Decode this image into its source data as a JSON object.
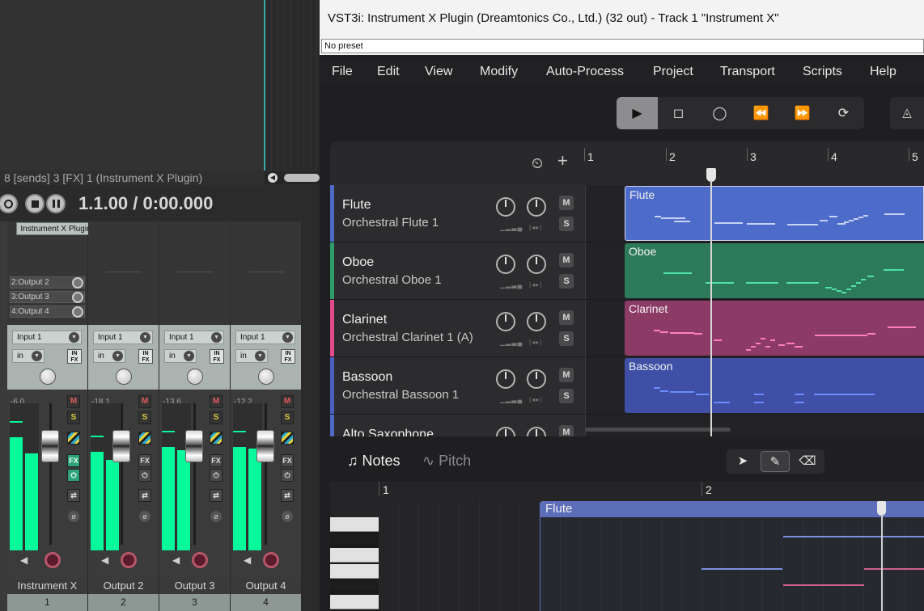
{
  "daw": {
    "info_line": "8 [sends] 3 [FX] 1 (Instrument X Plugin)",
    "time_display": "1.1.00 / 0:00.000",
    "fx_slot_label": "Instrument X Plugin",
    "sends": [
      "2:Output 2",
      "3:Output 3",
      "4:Output 4"
    ],
    "strips": [
      {
        "name": "Instrument X",
        "number": "1",
        "input": "Input 1",
        "monitor": "in",
        "db": "-6.0"
      },
      {
        "name": "Output 2",
        "number": "2",
        "input": "Input 1",
        "monitor": "in",
        "db": "-18.1"
      },
      {
        "name": "Output 3",
        "number": "3",
        "input": "Input 1",
        "monitor": "in",
        "db": "-13.6"
      },
      {
        "name": "Output 4",
        "number": "4",
        "input": "Input 1",
        "monitor": "in",
        "db": "-12.2"
      }
    ],
    "btn_m": "M",
    "btn_s": "S",
    "btn_fx": "FX",
    "infx": "IN FX",
    "meter_color": "#06f99b"
  },
  "plugin": {
    "title": "VST3i: Instrument X Plugin (Dreamtonics Co., Ltd.) (32 out) - Track 1 \"Instrument X\"",
    "preset": "No preset",
    "menu": [
      "File",
      "Edit",
      "View",
      "Modify",
      "Auto-Process",
      "Project",
      "Transport",
      "Scripts",
      "Help"
    ],
    "ruler": [
      "1",
      "2",
      "3",
      "4",
      "5"
    ],
    "tracks": [
      {
        "name": "Flute",
        "instrument": "Orchestral Flute 1",
        "color": "#4f6ac4",
        "clip_color": "#4d6bc9",
        "note_color": "#c7d2f4"
      },
      {
        "name": "Oboe",
        "instrument": "Orchestral Oboe 1",
        "color": "#2f9d6a",
        "clip_color": "#2c7a5a",
        "note_color": "#4fe3a5"
      },
      {
        "name": "Clarinet",
        "instrument": "Orchestral Clarinet 1 (A)",
        "color": "#e24b8c",
        "clip_color": "#8c3a66",
        "note_color": "#ff7fbf"
      },
      {
        "name": "Bassoon",
        "instrument": "Orchestral Bassoon 1",
        "color": "#4a5fbf",
        "clip_color": "#3e4fa5",
        "note_color": "#6b8cff"
      },
      {
        "name": "Alto Saxophone",
        "instrument": "",
        "color": "#4f6ac4",
        "clip_color": "#4d6bc9",
        "note_color": "#c7d2f4"
      }
    ],
    "btn_m": "M",
    "btn_s": "S",
    "tabs": {
      "notes": "Notes",
      "pitch": "Pitch"
    },
    "pr_ruler": [
      "1",
      "2"
    ],
    "pr_clip_name": "Flute"
  }
}
